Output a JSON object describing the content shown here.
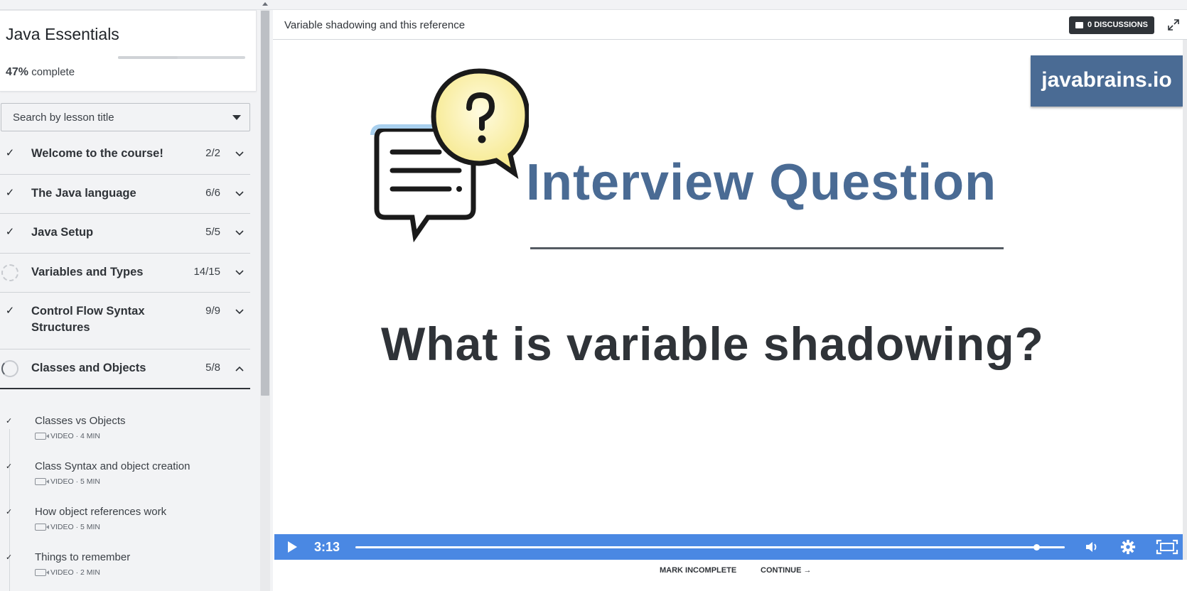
{
  "sidebar": {
    "course_title": "Java Essentials",
    "progress_percent": "47%",
    "progress_label": "complete",
    "progress_fraction": 0.47,
    "search_placeholder": "Search by lesson title",
    "sections": [
      {
        "title": "Welcome to the course!",
        "count": "2/2",
        "status": "complete",
        "expanded": false
      },
      {
        "title": "The Java language",
        "count": "6/6",
        "status": "complete",
        "expanded": false
      },
      {
        "title": "Java Setup",
        "count": "5/5",
        "status": "complete",
        "expanded": false
      },
      {
        "title": "Variables and Types",
        "count": "14/15",
        "status": "in-progress",
        "expanded": false
      },
      {
        "title": "Control Flow Syntax Structures",
        "count": "9/9",
        "status": "complete",
        "expanded": false
      },
      {
        "title": "Classes and Objects",
        "count": "5/8",
        "status": "in-progress",
        "expanded": true
      }
    ],
    "lessons": [
      {
        "title": "Classes vs Objects",
        "meta": "VIDEO · 4 MIN"
      },
      {
        "title": "Class Syntax and object creation",
        "meta": "VIDEO · 5 MIN"
      },
      {
        "title": "How object references work",
        "meta": "VIDEO · 5 MIN"
      },
      {
        "title": "Things to remember",
        "meta": "VIDEO · 2 MIN"
      }
    ]
  },
  "main": {
    "lesson_title": "Variable shadowing and this reference",
    "discussions_label": "0 DISCUSSIONS",
    "video": {
      "brand": "javabrains.io",
      "headline": "Interview Question",
      "question": "What is variable shadowing?",
      "time": "3:13",
      "played_fraction": 0.96
    },
    "footer": {
      "mark_label": "MARK INCOMPLETE",
      "continue_label": "CONTINUE →"
    }
  },
  "colors": {
    "accent_blue": "#4a88e3",
    "brand_blue": "#4a6b94",
    "dark": "#2f3338"
  }
}
